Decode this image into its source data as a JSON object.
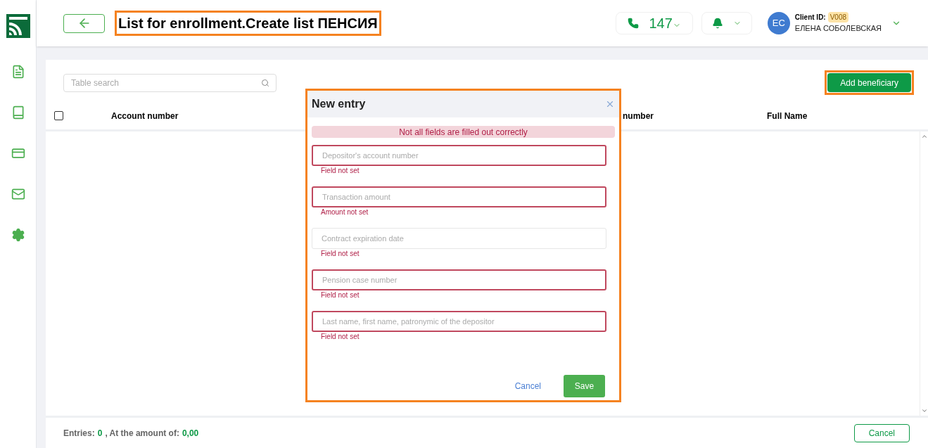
{
  "header": {
    "title": "List for enrollment.Create list ПЕНСИЯ",
    "calls": "147",
    "client_id_label": "Client ID:",
    "client_id": "V008",
    "avatar": "EC",
    "user_name": "ЕЛЕНА СОБОЛЕВСКАЯ"
  },
  "table": {
    "search_placeholder": "Table search",
    "add_button": "Add beneficiary",
    "select_all_checked": false,
    "columns": [
      "Account number",
      "number",
      "Full Name"
    ]
  },
  "footer": {
    "entries_label": "Entries:",
    "entries": "0",
    "amount_label": ", At the amount of:",
    "amount": "0,00",
    "cancel": "Cancel"
  },
  "dialog": {
    "title": "New entry",
    "alert": "Not all fields are filled out correctly",
    "fields": [
      {
        "placeholder": "Depositor's account number",
        "invalid": true,
        "error": "Field not set"
      },
      {
        "placeholder": "Transaction amount",
        "invalid": true,
        "error": "Amount not set"
      },
      {
        "placeholder": "Contract expiration date",
        "invalid": false,
        "error": "Field not set"
      },
      {
        "placeholder": "Pension case number",
        "invalid": true,
        "error": "Field not set"
      },
      {
        "placeholder": "Last name, first name, patronymic of the depositor",
        "invalid": true,
        "error": "Field not set"
      }
    ],
    "cancel": "Cancel",
    "save": "Save"
  }
}
